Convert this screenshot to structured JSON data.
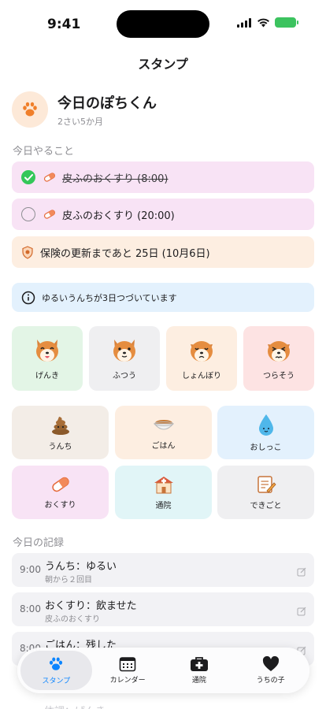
{
  "status": {
    "time": "9:41"
  },
  "nav": {
    "title": "スタンプ"
  },
  "pet": {
    "name": "今日のぽちくん",
    "age": "2さい5か月"
  },
  "todo": {
    "label": "今日やること",
    "tasks": [
      {
        "text": "皮ふのおくすり (8:00)",
        "done": true
      },
      {
        "text": "皮ふのおくすり (20:00)",
        "done": false
      }
    ],
    "insurance": "保険の更新まであと 25日 (10月6日)",
    "notice": "ゆるいうんちが3日つづいています"
  },
  "moods": [
    {
      "label": "げんき",
      "color": "#e3f5e6"
    },
    {
      "label": "ふつう",
      "color": "#efeff1"
    },
    {
      "label": "しょんぼり",
      "color": "#fdeee1"
    },
    {
      "label": "つらそう",
      "color": "#fde3e3"
    }
  ],
  "actions": [
    {
      "label": "うんち",
      "color": "#f3ede7"
    },
    {
      "label": "ごはん",
      "color": "#fdeee1"
    },
    {
      "label": "おしっこ",
      "color": "#e3f1fd"
    },
    {
      "label": "おくすり",
      "color": "#f8e3f5"
    },
    {
      "label": "通院",
      "color": "#e1f5f7"
    },
    {
      "label": "できごと",
      "color": "#efeff1"
    }
  ],
  "records": {
    "label": "今日の記録",
    "items": [
      {
        "time": "9:00",
        "title": "うんち：ゆるい",
        "sub": "朝から２回目"
      },
      {
        "time": "8:00",
        "title": "おくすり：飲ませた",
        "sub": "皮ふのおくすり"
      },
      {
        "time": "8:00",
        "title": "ごはん：残した",
        "sub": ""
      }
    ],
    "peek": "体調：げんき"
  },
  "tabs": [
    {
      "label": "スタンプ",
      "icon": "paw-icon",
      "active": true
    },
    {
      "label": "カレンダー",
      "icon": "calendar-icon",
      "active": false
    },
    {
      "label": "通院",
      "icon": "medical-kit-icon",
      "active": false
    },
    {
      "label": "うちの子",
      "icon": "heart-icon",
      "active": false
    }
  ]
}
